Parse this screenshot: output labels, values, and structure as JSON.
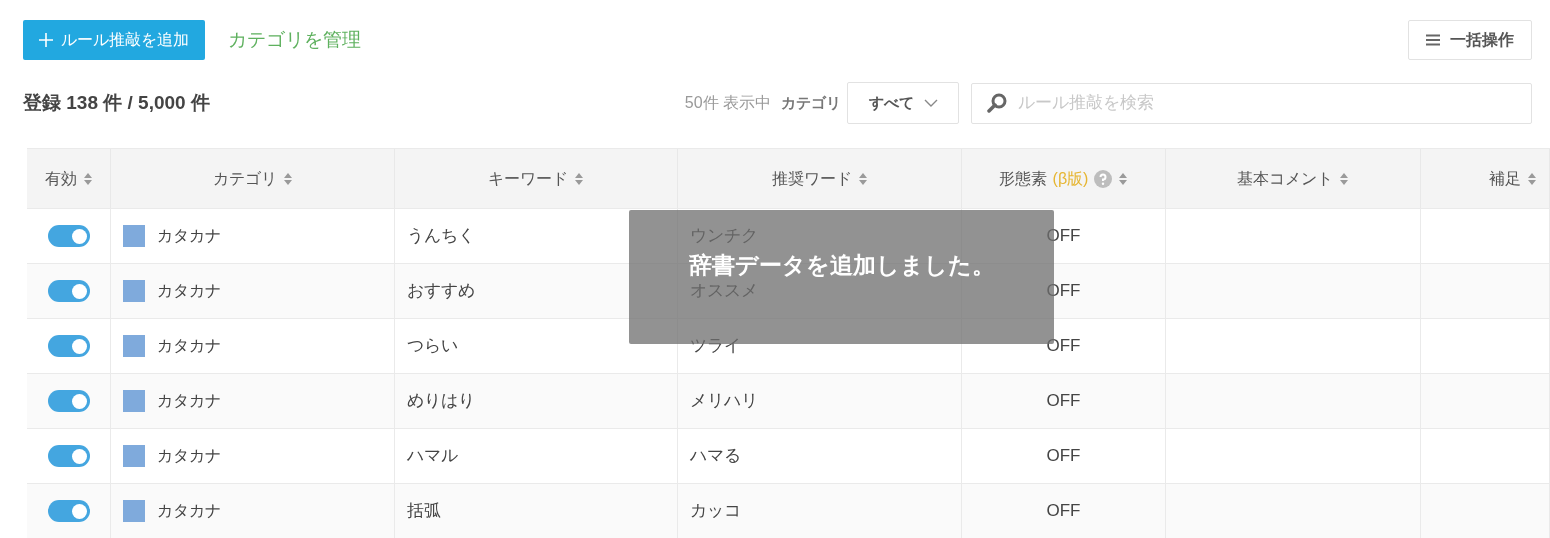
{
  "toolbar": {
    "add_button": "ルール推敲を追加",
    "manage_link": "カテゴリを管理",
    "bulk_button": "一括操作"
  },
  "summary": {
    "count": "登録 138 件 / 5,000 件",
    "showing": "50件 表示中",
    "category_label": "カテゴリ",
    "category_value": "すべて",
    "search_placeholder": "ルール推敲を検索"
  },
  "table": {
    "columns": [
      {
        "label": "有効"
      },
      {
        "label": "カテゴリ"
      },
      {
        "label": "キーワード"
      },
      {
        "label": "推奨ワード"
      },
      {
        "label": "形態素",
        "note": "(β版)",
        "help": true
      },
      {
        "label": "基本コメント"
      },
      {
        "label": "補足"
      }
    ],
    "rows": [
      {
        "enabled": true,
        "category": "カタカナ",
        "color": "#7faadc",
        "keyword": "うんちく",
        "suggested": "ウンチク",
        "morpheme": "OFF"
      },
      {
        "enabled": true,
        "category": "カタカナ",
        "color": "#7faadc",
        "keyword": "おすすめ",
        "suggested": "オススメ",
        "morpheme": "OFF"
      },
      {
        "enabled": true,
        "category": "カタカナ",
        "color": "#7faadc",
        "keyword": "つらい",
        "suggested": "ツライ",
        "morpheme": "OFF"
      },
      {
        "enabled": true,
        "category": "カタカナ",
        "color": "#7faadc",
        "keyword": "めりはり",
        "suggested": "メリハリ",
        "morpheme": "OFF"
      },
      {
        "enabled": true,
        "category": "カタカナ",
        "color": "#7faadc",
        "keyword": "ハマル",
        "suggested": "ハマる",
        "morpheme": "OFF"
      },
      {
        "enabled": true,
        "category": "カタカナ",
        "color": "#7faadc",
        "keyword": "括弧",
        "suggested": "カッコ",
        "morpheme": "OFF"
      }
    ]
  },
  "toast": {
    "message": "辞書データを追加しました。"
  }
}
